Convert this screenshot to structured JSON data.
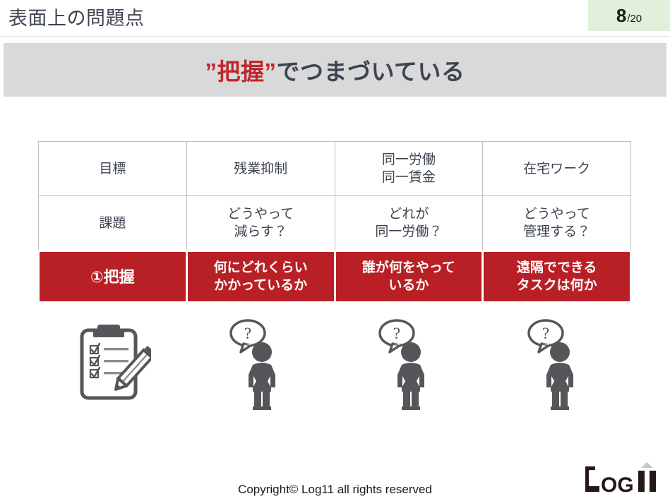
{
  "header": {
    "title": "表面上の問題点",
    "page_current": "8",
    "page_total": "/20",
    "badge_color": "#e2efda"
  },
  "subtitle": {
    "quote_open": "”",
    "highlight": "把握",
    "quote_close": "”",
    "rest": "でつまづいている",
    "full_text": "”把握”でつまづいている",
    "banner_color": "#d9d9d9",
    "highlight_color": "#c0262b"
  },
  "table": {
    "accent_color": "#b82025",
    "border_color": "#bfbfbf",
    "rows": [
      {
        "name": "goal",
        "label": "目標",
        "cells": [
          "残業抑制",
          "同一労働\n同一賃金",
          "在宅ワーク"
        ],
        "cells_lines": [
          [
            "残業抑制"
          ],
          [
            "同一労働",
            "同一賃金"
          ],
          [
            "在宅ワーク"
          ]
        ]
      },
      {
        "name": "issue",
        "label": "課題",
        "cells_lines": [
          [
            "どうやって",
            "減らす？"
          ],
          [
            "どれが",
            "同一労働？"
          ],
          [
            "どうやって",
            "管理する？"
          ]
        ]
      },
      {
        "name": "grasp",
        "label": "①把握",
        "cells_lines": [
          [
            "何にどれくらい",
            "かかっているか"
          ],
          [
            "誰が何をやって",
            "いるか"
          ],
          [
            "遠隔でできる",
            "タスクは何か"
          ]
        ]
      }
    ]
  },
  "icons": [
    {
      "name": "clipboard-checklist-icon",
      "alt": "チェックリストとペン"
    },
    {
      "name": "person-question-icon",
      "alt": "疑問を持つ人"
    },
    {
      "name": "person-question-icon",
      "alt": "疑問を持つ人"
    },
    {
      "name": "person-question-icon",
      "alt": "疑問を持つ人"
    }
  ],
  "footer": {
    "copyright": "Copyright© Log11 all rights reserved",
    "logo_text": "LOG11"
  }
}
